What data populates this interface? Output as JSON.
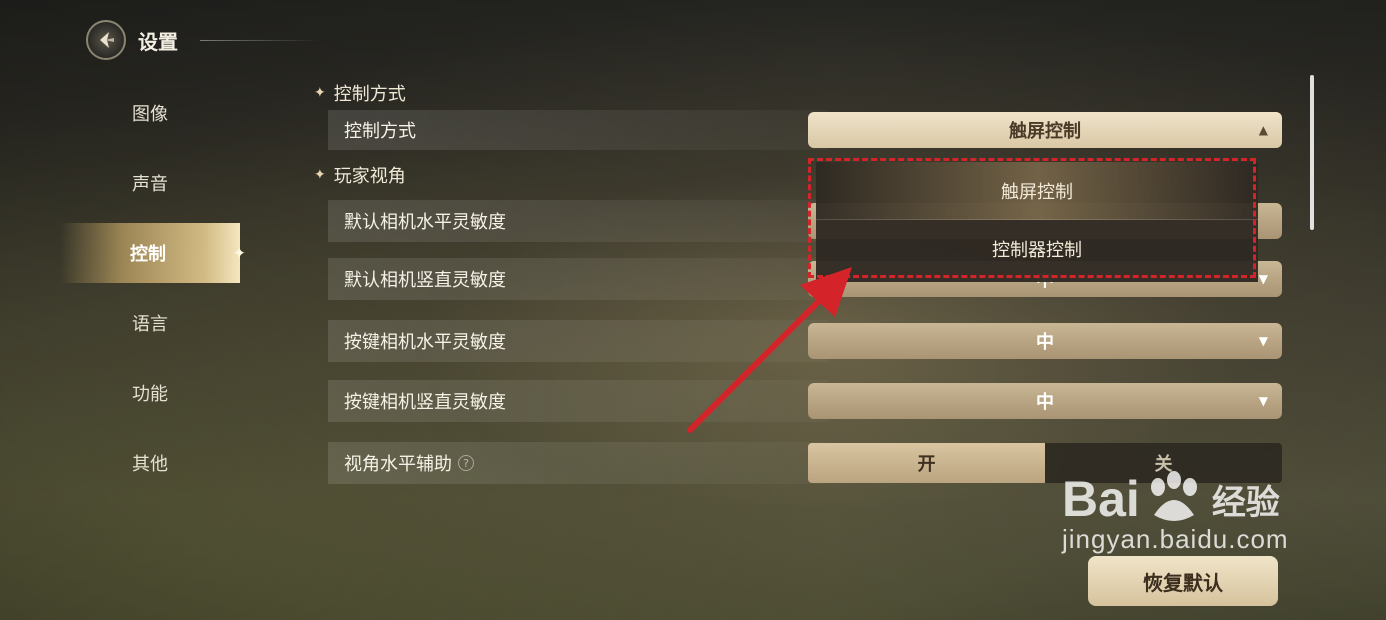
{
  "header": {
    "title": "设置"
  },
  "sidebar": {
    "items": [
      {
        "label": "图像"
      },
      {
        "label": "声音"
      },
      {
        "label": "控制"
      },
      {
        "label": "语言"
      },
      {
        "label": "功能"
      },
      {
        "label": "其他"
      }
    ],
    "active": "控制"
  },
  "sections": {
    "control_mode_title": "控制方式",
    "player_view_title": "玩家视角"
  },
  "rows": {
    "control_mode": {
      "label": "控制方式",
      "value": "触屏控制"
    },
    "cam_h_default": {
      "label": "默认相机水平灵敏度"
    },
    "cam_v_default": {
      "label": "默认相机竖直灵敏度",
      "value": "中"
    },
    "cam_h_key": {
      "label": "按键相机水平灵敏度",
      "value": "中"
    },
    "cam_v_key": {
      "label": "按键相机竖直灵敏度",
      "value": "中"
    },
    "view_assist": {
      "label": "视角水平辅助",
      "on": "开",
      "off": "关",
      "help": "?"
    }
  },
  "dropdown": {
    "options": [
      "触屏控制",
      "控制器控制"
    ],
    "selected": "触屏控制"
  },
  "reset_label": "恢复默认",
  "watermark": {
    "brand": "Bai",
    "brand_cn": "经验",
    "url": "jingyan.baidu.com"
  },
  "colors": {
    "annotation": "#d4242a",
    "accent": "#c8b694"
  }
}
